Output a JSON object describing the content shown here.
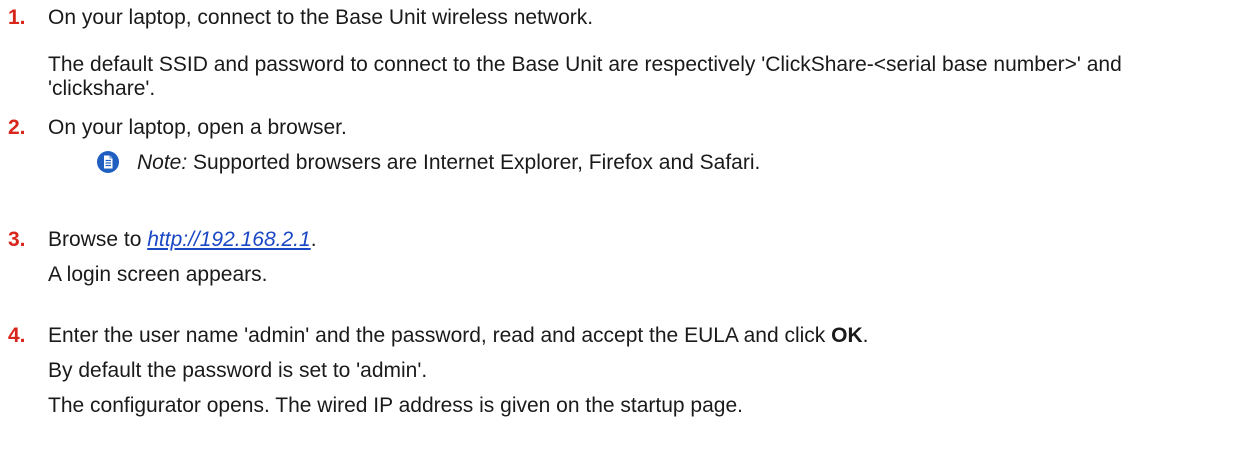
{
  "steps": [
    {
      "number": "1.",
      "text": "On your laptop, connect to the Base Unit wireless network.",
      "detail": "The default SSID and password to connect to the Base Unit are respectively 'ClickShare-<serial base number>' and 'clickshare'."
    },
    {
      "number": "2.",
      "text": "On your laptop, open a browser.",
      "note": {
        "label": "Note:",
        "text": " Supported browsers are Internet Explorer, Firefox and Safari.",
        "icon": "note-icon"
      }
    },
    {
      "number": "3.",
      "text_before": "Browse to ",
      "link": "http://192.168.2.1",
      "text_after": ".",
      "detail": "A login screen appears."
    },
    {
      "number": "4.",
      "text_before": "Enter the user name 'admin' and the password, read and accept the EULA and click ",
      "bold": "OK",
      "text_after": ".",
      "detail_1": "By default the password is set to 'admin'.",
      "detail_2": "The configurator opens. The wired IP address is given on the startup page."
    }
  ],
  "colors": {
    "step_number": "#d9261c",
    "link": "#1a47c4",
    "note_icon": "#1f5fbf",
    "text": "#1a1a1a"
  }
}
